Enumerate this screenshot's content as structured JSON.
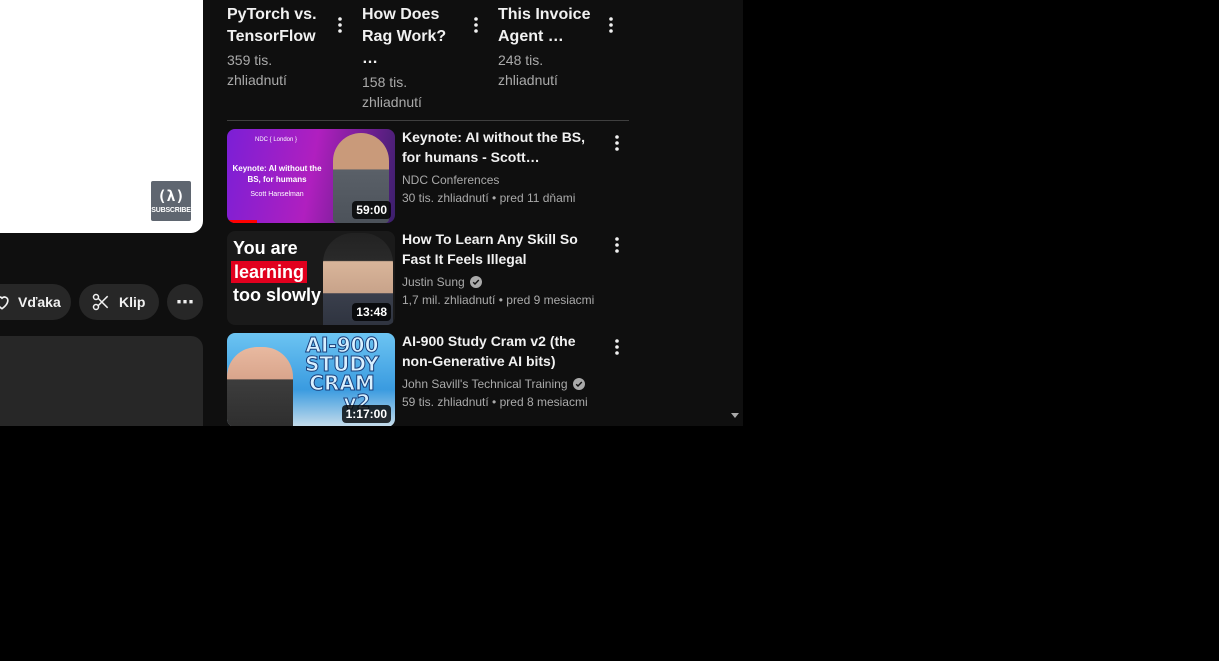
{
  "player": {
    "subscribe_watermark": "SUBSCRIBE",
    "watermark_glyph": "(λ)"
  },
  "actions": {
    "thanks_label": "Vďaka",
    "clip_label": "Klip",
    "more_label": "⋯"
  },
  "shorts": [
    {
      "title": "PyTorch vs. TensorFlow",
      "views": "359 tis. zhliadnutí"
    },
    {
      "title": "How Does Rag Work? …",
      "views": "158 tis. zhliadnutí"
    },
    {
      "title": "This Invoice Agent …",
      "views": "248 tis. zhliadnutí"
    }
  ],
  "videos": [
    {
      "title": "Keynote: AI without the BS, for humans - Scott Hanselman - NDC London",
      "channel": "NDC Conferences",
      "verified": false,
      "views": "30 tis. zhliadnutí",
      "age": "pred 11 dňami",
      "duration": "59:00",
      "thumb": {
        "label": "NDC { London }",
        "headline": "Keynote: AI without the BS, for humans",
        "name": "Scott Hanselman"
      }
    },
    {
      "title": "How To Learn Any Skill So Fast It Feels Illegal",
      "channel": "Justin Sung",
      "verified": true,
      "views": "1,7 mil. zhliadnutí",
      "age": "pred 9 mesiacmi",
      "duration": "13:48",
      "thumb": {
        "line1": "You are",
        "line2": "learning",
        "line3": "too slowly"
      }
    },
    {
      "title": "AI-900 Study Cram v2 (the non-Generative AI bits)",
      "channel": "John Savill's Technical Training",
      "verified": true,
      "views": "59 tis. zhliadnutí",
      "age": "pred 8 mesiacmi",
      "duration": "1:17:00",
      "thumb": {
        "line1": "AI-900",
        "line2": "STUDY",
        "line3": "CRAM",
        "line4": "v2"
      }
    }
  ],
  "colors": {
    "background": "#0f0f0f",
    "pill": "#272727",
    "secondary_text": "#aaaaaa"
  }
}
